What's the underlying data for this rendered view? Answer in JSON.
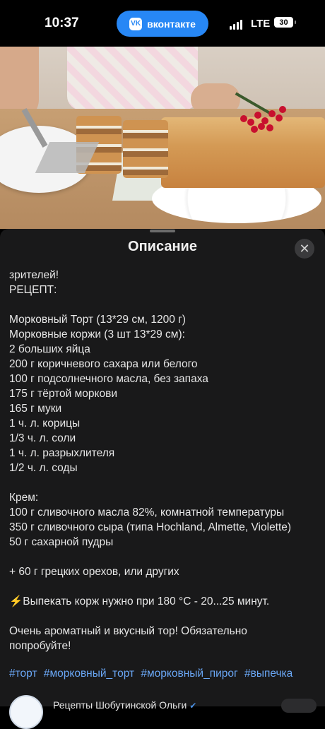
{
  "status_bar": {
    "time": "10:37",
    "app_pill_label": "вконтакте",
    "network": "LTE",
    "battery": "30"
  },
  "sheet": {
    "title": "Описание",
    "close_icon": "close-icon",
    "lines": [
      "зрителей!",
      "РЕЦЕПТ:",
      "",
      "Морковный Торт (13*29 см, 1200 г)",
      "Морковные коржи (3 шт 13*29 см):",
      "2 больших яйца",
      "200 г коричневого сахара или белого",
      "100 г подсолнечного масла, без запаха",
      "175 г тёртой моркови",
      "165 г муки",
      "1 ч. л. корицы",
      "1/3 ч. л. соли",
      "1 ч. л. разрыхлителя",
      "1/2 ч. л. соды",
      "",
      "Крем:",
      "100 г сливочного масла 82%, комнатной температуры",
      "350 г сливочного сыра (типа Hochland, Almette, Violette)",
      "50 г сахарной пудры",
      "",
      "+ 60 г грецких орехов, или других",
      "",
      "⚡Выпекать корж нужно при 180 °С - 20...25 минут.",
      "",
      "Очень ароматный и вкусный тор! Обязательно",
      "попробуйте!"
    ],
    "hashtags": [
      "#торт",
      "#морковный_торт",
      "#морковный_пирог",
      "#выпечка"
    ],
    "author_name": "Рецепты Шобутинской Ольги"
  }
}
